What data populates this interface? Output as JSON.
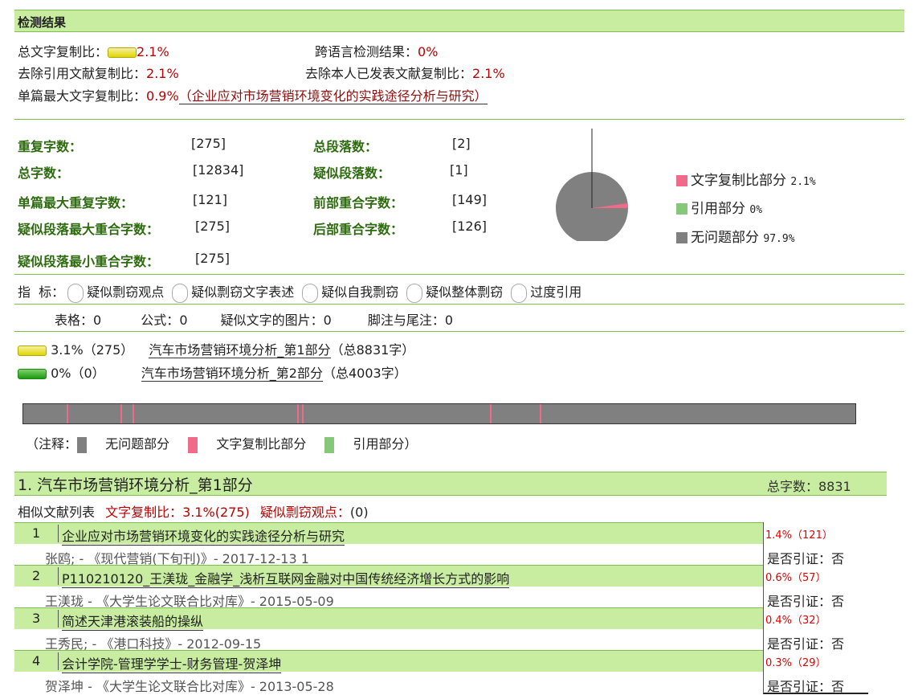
{
  "header": {
    "title": "检测结果"
  },
  "summary": {
    "total_label": "总文字复制比：",
    "total_value": "2.1%",
    "cross_lang_label": "跨语言检测结果：",
    "cross_lang_value": "0%",
    "excl_quote_label": "去除引用文献复制比：",
    "excl_quote_value": "2.1%",
    "excl_self_label": "去除本人已发表文献复制比：",
    "excl_self_value": "2.1%",
    "single_max_label": "单篇最大文字复制比：",
    "single_max_value": "0.9%",
    "single_max_title": "（企业应对市场营销环境变化的实践途径分析与研究）"
  },
  "stats": {
    "dup_chars_label": "重复字数：",
    "dup_chars": "[275]",
    "total_para_label": "总段落数：",
    "total_para": "[2]",
    "total_chars_label": "总字数：",
    "total_chars": "[12834]",
    "sus_para_label": "疑似段落数：",
    "sus_para": "[1]",
    "single_max_dup_label": "单篇最大重复字数：",
    "single_max_dup": "[121]",
    "front_overlap_label": "前部重合字数：",
    "front_overlap": "[149]",
    "sus_max_label": "疑似段落最大重合字数：",
    "sus_max": "[275]",
    "back_overlap_label": "后部重合字数：",
    "back_overlap": "[126]",
    "sus_min_label": "疑似段落最小重合字数：",
    "sus_min": "[275]"
  },
  "pie": {
    "legend": [
      {
        "label": "文字复制比部分",
        "value": "2.1%",
        "color": "#f06a8a"
      },
      {
        "label": "引用部分",
        "value": "0%",
        "color": "#86c77a"
      },
      {
        "label": "无问题部分",
        "value": "97.9%",
        "color": "#808080"
      }
    ]
  },
  "indicators": {
    "label": "指  标：",
    "items": [
      "疑似剽窃观点",
      "疑似剽窃文字表述",
      "疑似自我剽窃",
      "疑似整体剽窃",
      "过度引用"
    ]
  },
  "counts": {
    "table_label": "表格：",
    "table_value": "0",
    "formula_label": "公式：",
    "formula_value": "0",
    "image_label": "疑似文字的图片：",
    "image_value": "0",
    "footnote_label": "脚注与尾注：",
    "footnote_value": "0"
  },
  "parts": [
    {
      "stat": "3.1%（275）",
      "title": "汽车市场营销环境分析_第1部分",
      "total": "（总8831字）"
    },
    {
      "stat": "0%（0）",
      "title": "汽车市场营销环境分析_第2部分",
      "total": "（总4003字）"
    }
  ],
  "timeline_marks": [
    0.052,
    0.117,
    0.131,
    0.329,
    0.335,
    0.561,
    0.621
  ],
  "note": {
    "prefix": "（注释：",
    "items": [
      "无问题部分",
      "文字复制比部分",
      "引用部分）"
    ]
  },
  "section": {
    "title": "1. 汽车市场营销环境分析_第1部分",
    "total_label": "总字数：8831",
    "list_title": "相似文献列表",
    "ratio_label": "文字复制比：3.1%(275)",
    "plag_label": "疑似剽窃观点：",
    "plag_value": "(0)"
  },
  "results": [
    {
      "num": "1",
      "title": "企业应对市场营销环境变化的实践途径分析与研究",
      "pct": "1.4%（121）",
      "meta": "张鸥; - 《现代营销(下旬刊)》- 2017-12-13 1",
      "cite": "是否引证：否"
    },
    {
      "num": "2",
      "title": "P110210120_王渼珑_金融学_浅析互联网金融对中国传统经济增长方式的影响",
      "pct": "0.6%（57）",
      "meta": "王渼珑 - 《大学生论文联合比对库》- 2015-05-09",
      "cite": "是否引证：否"
    },
    {
      "num": "3",
      "title": "简述天津港滚装船的操纵",
      "pct": "0.4%（32）",
      "meta": "王秀民; - 《港口科技》- 2012-09-15",
      "cite": "是否引证：否"
    },
    {
      "num": "4",
      "title": "会计学院-管理学学士-财务管理-贺泽坤",
      "pct": "0.3%（29）",
      "meta": "贺泽坤 - 《大学生论文联合比对库》- 2013-05-28",
      "cite": "是否引证：否"
    }
  ]
}
